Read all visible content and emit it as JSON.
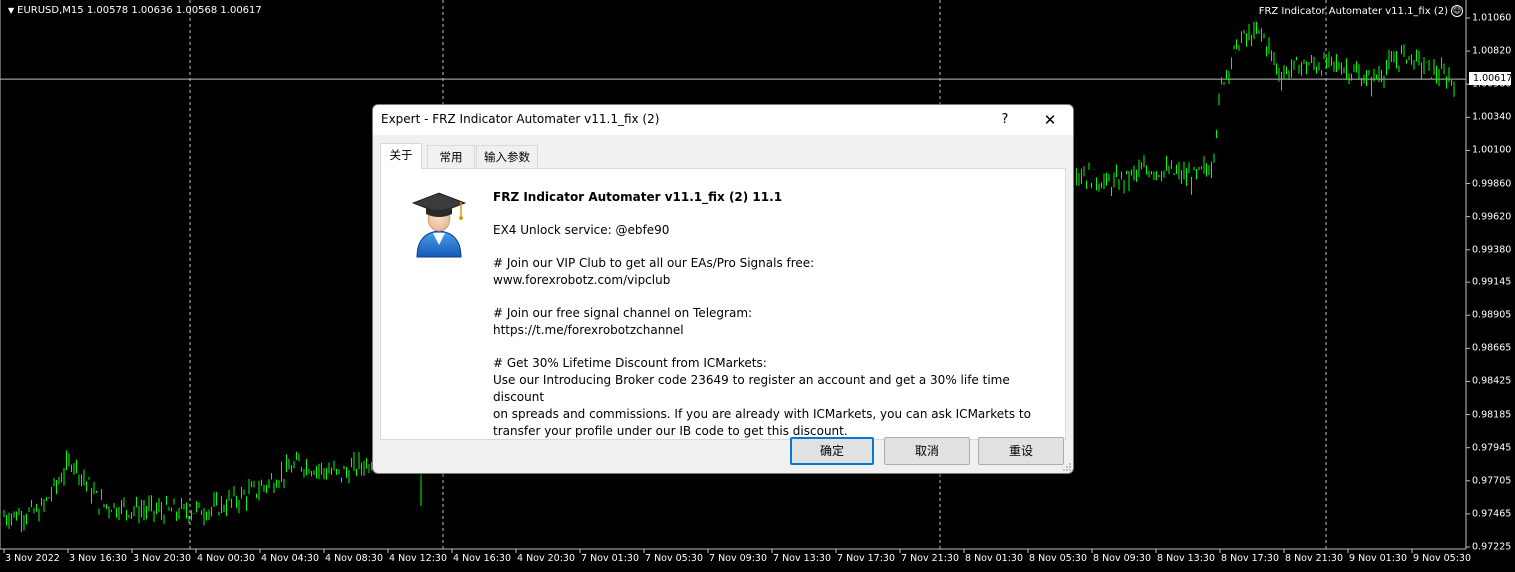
{
  "chart": {
    "symbol_label": "EURUSD,M15  1.00578 1.00636 1.00568 1.00617",
    "ea_label": "FRZ Indicator Automater v11.1_fix (2)",
    "current_price": "1.00617",
    "price_ticks": [
      {
        "label": "1.01060",
        "value": 1.0106
      },
      {
        "label": "1.00820",
        "value": 1.0082
      },
      {
        "label": "1.00580",
        "value": 1.0058
      },
      {
        "label": "1.00340",
        "value": 1.0034
      },
      {
        "label": "1.00100",
        "value": 1.001
      },
      {
        "label": "0.99860",
        "value": 0.9986
      },
      {
        "label": "0.99620",
        "value": 0.9962
      },
      {
        "label": "0.99380",
        "value": 0.9938
      },
      {
        "label": "0.99145",
        "value": 0.99145
      },
      {
        "label": "0.98905",
        "value": 0.98905
      },
      {
        "label": "0.98665",
        "value": 0.98665
      },
      {
        "label": "0.98425",
        "value": 0.98425
      },
      {
        "label": "0.98185",
        "value": 0.98185
      },
      {
        "label": "0.97945",
        "value": 0.97945
      },
      {
        "label": "0.97705",
        "value": 0.97705
      },
      {
        "label": "0.97465",
        "value": 0.97465
      },
      {
        "label": "0.97225",
        "value": 0.97225
      }
    ],
    "time_ticks": [
      "3 Nov 2022",
      "3 Nov 16:30",
      "3 Nov 20:30",
      "4 Nov 00:30",
      "4 Nov 04:30",
      "4 Nov 08:30",
      "4 Nov 12:30",
      "4 Nov 16:30",
      "4 Nov 20:30",
      "7 Nov 01:30",
      "7 Nov 05:30",
      "7 Nov 09:30",
      "7 Nov 13:30",
      "7 Nov 17:30",
      "7 Nov 21:30",
      "8 Nov 01:30",
      "8 Nov 05:30",
      "8 Nov 09:30",
      "8 Nov 13:30",
      "8 Nov 17:30",
      "8 Nov 21:30",
      "9 Nov 01:30",
      "9 Nov 05:30"
    ],
    "colors": {
      "background": "#000000",
      "candles": "#00ff00",
      "grid": "#c0c0c0",
      "text": "#ffffff"
    }
  },
  "dialog": {
    "title": "Expert - FRZ Indicator Automater v11.1_fix (2)",
    "help_glyph": "?",
    "close_glyph": "✕",
    "tabs": [
      {
        "label": "关于",
        "active": true
      },
      {
        "label": "常用",
        "active": false
      },
      {
        "label": "输入参数",
        "active": false
      }
    ],
    "about": {
      "heading": "FRZ Indicator Automater v11.1_fix (2) 11.1",
      "lines": [
        "EX4 Unlock service: @ebfe90",
        "# Join our VIP Club to get all our EAs/Pro Signals free:\nwww.forexrobotz.com/vipclub",
        "# Join our free signal channel on Telegram:\nhttps://t.me/forexrobotzchannel",
        "# Get 30% Lifetime Discount from ICMarkets:\nUse our Introducing Broker code 23649 to register an account and get a 30% life time discount\non spreads and commissions. If you are already with ICMarkets, you can ask ICMarkets to\ntransfer your profile under our IB code to get this discount."
      ]
    },
    "buttons": {
      "ok": "确定",
      "cancel": "取消",
      "reset": "重设"
    },
    "icon": "graduate-avatar-icon"
  }
}
